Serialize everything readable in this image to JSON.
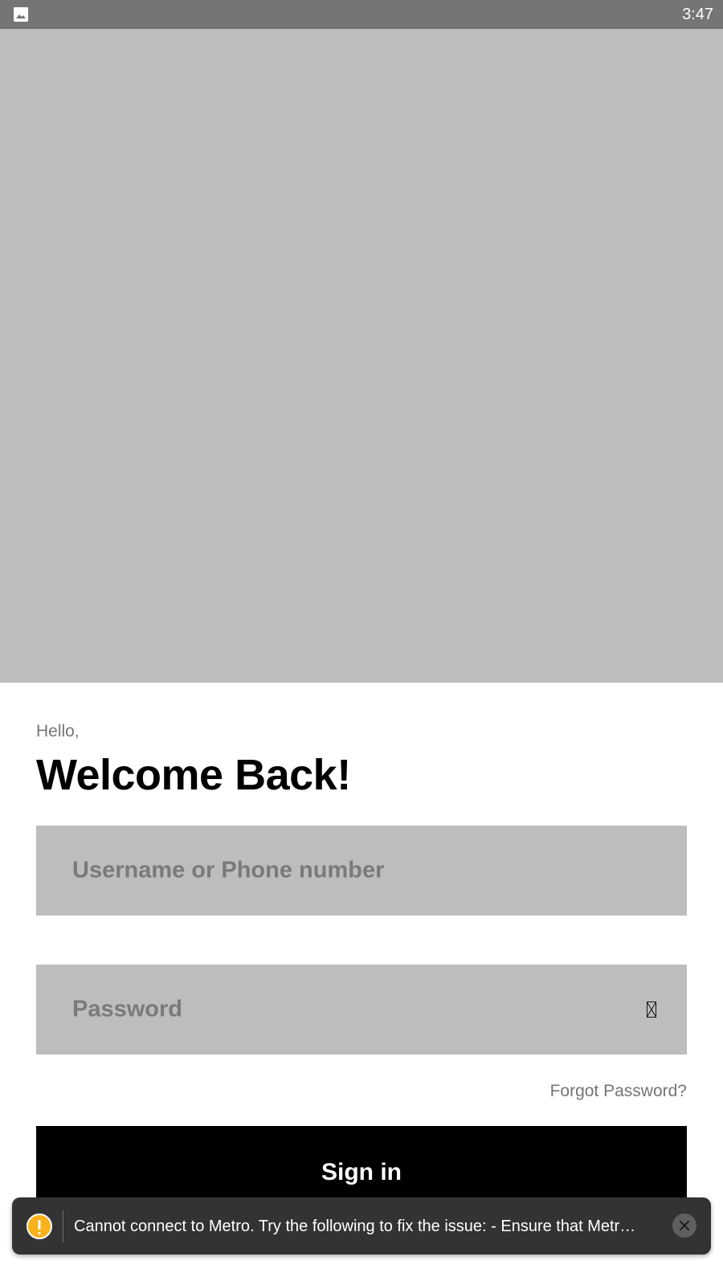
{
  "status_bar": {
    "time": "3:47",
    "notification_icon": "image-icon",
    "background": "#757575"
  },
  "hero": {
    "background": "#bdbdbd"
  },
  "login": {
    "greeting": "Hello,",
    "title": "Welcome Back!",
    "username_placeholder": "Username or Phone number",
    "password_placeholder": "Password",
    "password_toggle_icon": "eye-toggle-icon",
    "forgot_password": "Forgot Password?",
    "sign_in_label": "Sign in"
  },
  "toast": {
    "icon": "warning-icon",
    "message": "Cannot connect to Metro.  Try the following to fix the issue: - Ensure that Metr…",
    "dismiss_icon": "close-icon",
    "accent": "#f9b21c"
  }
}
